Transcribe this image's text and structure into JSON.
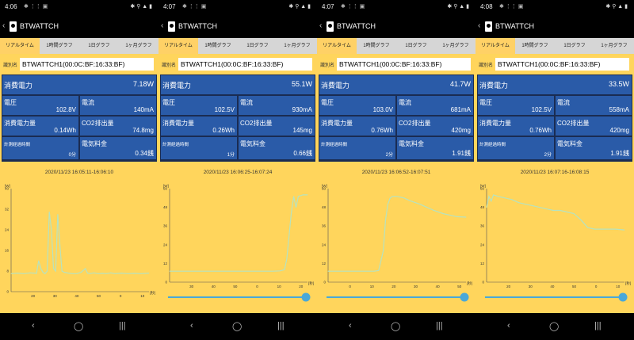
{
  "app_title": "BTWATTCH",
  "tabs": [
    "リアルタイム",
    "1時間グラフ",
    "1日グラフ",
    "1ヶ月グラフ"
  ],
  "labels": {
    "id": "識別名",
    "power": "消費電力",
    "voltage": "電圧",
    "current": "電流",
    "energy": "消費電力量",
    "co2": "CO2排出量",
    "elapsed": "計測経過時間",
    "cost": "電気料金"
  },
  "nav": {
    "back": "‹",
    "home": "◯",
    "recent": "|||"
  },
  "colors": {
    "content_bg": "#ffd55c",
    "cell_bg": "#2a5ba8",
    "line": "#b6e3c0",
    "slider": "#4aa8d8"
  },
  "screens": [
    {
      "status_time": "4:06",
      "device_id": "BTWATTCH1(00:0C:BF:16:33:BF)",
      "power": "7.18W",
      "voltage": "102.8V",
      "current": "140mA",
      "energy": "0.14Wh",
      "co2": "74.8mg",
      "elapsed": "0分",
      "cost": "0.34銭",
      "time_range": "2020/11/23 16:05:11-16:06:10",
      "has_slider": false,
      "chart_data": {
        "type": "line",
        "xlabel": "[秒]",
        "ylabel": "[W]",
        "x_ticks": [
          "20",
          "30",
          "40",
          "50",
          "0",
          "10"
        ],
        "y_ticks": [
          "40",
          "32",
          "24",
          "16",
          "8",
          "0"
        ],
        "ylim": [
          0,
          40
        ],
        "grid": false,
        "x": [
          0,
          3,
          6,
          9,
          12,
          13,
          14,
          15,
          16,
          17,
          18,
          19,
          20,
          21,
          22,
          23,
          24,
          25,
          27,
          29,
          31,
          33,
          35,
          36,
          37,
          39,
          41,
          43,
          45,
          47,
          49,
          52,
          55,
          58,
          61,
          65
        ],
        "values": [
          7,
          7.2,
          7,
          7.3,
          7.1,
          12,
          9,
          7.5,
          7,
          8,
          31,
          24,
          9,
          8,
          30,
          18,
          8,
          7.5,
          7.2,
          7,
          7,
          7.5,
          9,
          7.2,
          7,
          7.3,
          7,
          7.1,
          7,
          7.3,
          7,
          7.2,
          7,
          7.1,
          7,
          7.2
        ]
      }
    },
    {
      "status_time": "4:07",
      "device_id": "BTWATTCH1(00:0C:BF:16:33:BF)",
      "power": "55.1W",
      "voltage": "102.5V",
      "current": "930mA",
      "energy": "0.26Wh",
      "co2": "145mg",
      "elapsed": "1分",
      "cost": "0.66銭",
      "time_range": "2020/11/23 16:06:25-16:07:24",
      "has_slider": true,
      "chart_data": {
        "type": "line",
        "xlabel": "[秒]",
        "ylabel": "[W]",
        "x_ticks": [
          "30",
          "40",
          "50",
          "0",
          "10",
          "20"
        ],
        "y_ticks": [
          "60",
          "48",
          "36",
          "24",
          "12",
          "0"
        ],
        "ylim": [
          0,
          60
        ],
        "grid": false,
        "x": [
          0,
          10,
          20,
          30,
          40,
          45,
          48,
          50,
          51,
          52,
          53,
          54,
          55,
          56,
          58,
          60
        ],
        "values": [
          7,
          7,
          7,
          7,
          7,
          7,
          7.2,
          8,
          15,
          30,
          45,
          55,
          48,
          55,
          56,
          56
        ]
      }
    },
    {
      "status_time": "4:07",
      "device_id": "BTWATTCH1(00:0C:BF:16:33:BF)",
      "power": "41.7W",
      "voltage": "103.0V",
      "current": "681mA",
      "energy": "0.76Wh",
      "co2": "420mg",
      "elapsed": "2分",
      "cost": "1.91銭",
      "time_range": "2020/11/23 16:06:52-16:07:51",
      "has_slider": true,
      "chart_data": {
        "type": "line",
        "xlabel": "[秒]",
        "ylabel": "[W]",
        "x_ticks": [
          "0",
          "10",
          "20",
          "30",
          "40",
          "50"
        ],
        "y_ticks": [
          "60",
          "48",
          "36",
          "24",
          "12",
          "0"
        ],
        "ylim": [
          0,
          60
        ],
        "grid": false,
        "x": [
          0,
          5,
          10,
          15,
          20,
          22,
          24,
          25,
          26,
          27,
          28,
          30,
          33,
          36,
          40,
          43,
          46,
          50,
          53,
          56,
          60
        ],
        "values": [
          7,
          7,
          7,
          7,
          7,
          7.5,
          20,
          40,
          50,
          54,
          55,
          55,
          54,
          52,
          50,
          48,
          46,
          44,
          43,
          42,
          41.7
        ]
      }
    },
    {
      "status_time": "4:08",
      "device_id": "BTWATTCH1(00:0C:BF:16:33:BF)",
      "power": "33.5W",
      "voltage": "102.5V",
      "current": "558mA",
      "energy": "0.76Wh",
      "co2": "420mg",
      "elapsed": "2分",
      "cost": "1.91銭",
      "time_range": "2020/11/23 16:07:16-16:08:15",
      "has_slider": true,
      "chart_data": {
        "type": "line",
        "xlabel": "[秒]",
        "ylabel": "[W]",
        "x_ticks": [
          "20",
          "30",
          "40",
          "50",
          "0",
          "10"
        ],
        "y_ticks": [
          "60",
          "48",
          "36",
          "24",
          "12",
          "0"
        ],
        "ylim": [
          0,
          60
        ],
        "grid": false,
        "x": [
          0,
          1,
          2,
          3,
          5,
          8,
          11,
          14,
          17,
          20,
          23,
          26,
          29,
          32,
          35,
          38,
          41,
          44,
          47,
          50,
          53,
          56,
          60
        ],
        "values": [
          48,
          55,
          52,
          56,
          55,
          54,
          53,
          51,
          50,
          49,
          48,
          47,
          46,
          46,
          45,
          44,
          40,
          35,
          34,
          34,
          34,
          34,
          33.5
        ]
      }
    }
  ]
}
